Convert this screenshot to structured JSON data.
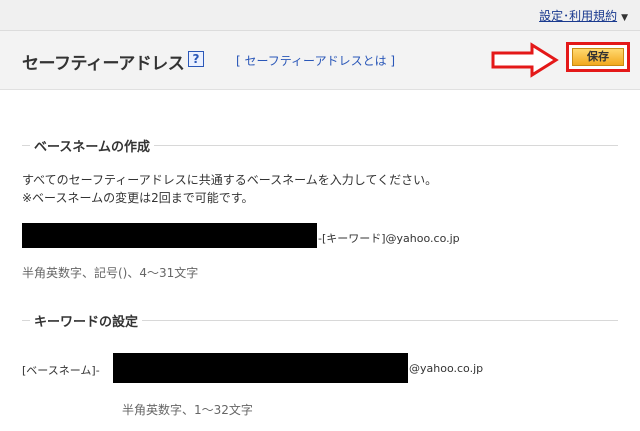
{
  "topbar": {
    "settings_link": "設定･利用規約"
  },
  "header": {
    "title": "セーフティーアドレス",
    "help_icon": "?",
    "about_link": "セーフティーアドレスとは",
    "save_button": "保存"
  },
  "basename_section": {
    "heading": "ベースネームの作成",
    "desc_line1": "すべてのセーフティーアドレスに共通するベースネームを入力してください。",
    "desc_line2": "※ベースネームの変更は2回まで可能です。",
    "suffix": "-[キーワード]@yahoo.co.jp",
    "hint": "半角英数字、記号()、4～31文字"
  },
  "keyword_section": {
    "heading": "キーワードの設定",
    "prefix": "[ベースネーム]-",
    "suffix": "@yahoo.co.jp",
    "hint": "半角英数字、1～32文字"
  },
  "colors": {
    "accent_red": "#e41919",
    "link_blue": "#2a57b8",
    "save_button_orange": "#f2a81e"
  },
  "icons": {
    "help": "question-mark-icon",
    "arrow": "right-arrow-icon",
    "dropdown": "chevron-down-icon"
  }
}
